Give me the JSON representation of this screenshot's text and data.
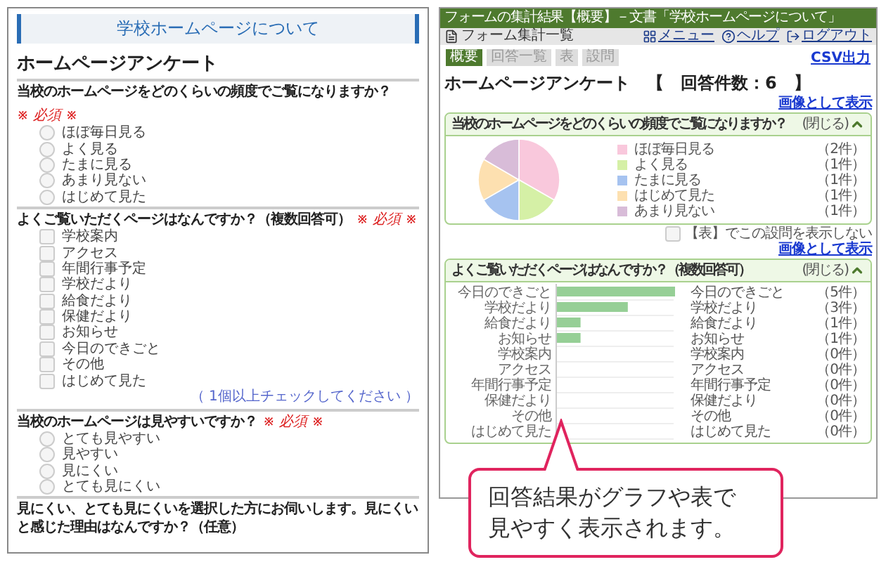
{
  "form": {
    "banner": "学校ホームページについて",
    "heading": "ホームページアンケート",
    "questions": [
      {
        "kind": "radio",
        "text": "当校のホームページをどのくらいの頻度でご覧になりますか？",
        "required_mark": "※ 必須 ※",
        "options": [
          {
            "label": "ほぼ毎日見る",
            "selected": false
          },
          {
            "label": "よく見る",
            "selected": false
          },
          {
            "label": "たまに見る",
            "selected": false
          },
          {
            "label": "あまり見ない",
            "selected": false
          },
          {
            "label": "はじめて見た",
            "selected": false
          }
        ]
      },
      {
        "kind": "checkbox",
        "text": "よくご覧いただくページはなんですか？（複数回答可）",
        "required_mark": "※ 必須 ※",
        "options": [
          {
            "label": "学校案内",
            "checked": false
          },
          {
            "label": "アクセス",
            "checked": false
          },
          {
            "label": "年間行事予定",
            "checked": false
          },
          {
            "label": "学校だより",
            "checked": false
          },
          {
            "label": "給食だより",
            "checked": false
          },
          {
            "label": "保健だより",
            "checked": false
          },
          {
            "label": "お知らせ",
            "checked": false
          },
          {
            "label": "今日のできごと",
            "checked": false
          },
          {
            "label": "その他",
            "checked": false
          },
          {
            "label": "はじめて見た",
            "checked": false
          }
        ],
        "hint": "（ 1個以上チェックしてください ）"
      },
      {
        "kind": "radio",
        "text": "当校のホームページは見やすいですか？",
        "required_mark": "※ 必須 ※",
        "options": [
          {
            "label": "とても見やすい",
            "selected": false
          },
          {
            "label": "見やすい",
            "selected": false
          },
          {
            "label": "見にくい",
            "selected": false
          },
          {
            "label": "とても見にくい",
            "selected": false
          }
        ]
      },
      {
        "kind": "text",
        "text": "見にくい、とても見にくいを選択した方にお伺いします。見にくいと感じた理由はなんですか？（任意）"
      }
    ]
  },
  "results": {
    "title_bar": "フォームの集計結果【概要】－文書「学校ホームページについて」",
    "menu_links": [
      {
        "kind": "menu",
        "label": "メニュー"
      },
      {
        "kind": "help",
        "label": "ヘルプ"
      },
      {
        "kind": "logout",
        "label": "ログアウト"
      }
    ],
    "breadcrumb": "フォーム集計一覧",
    "tabs": [
      {
        "label": "概要",
        "selected": true
      },
      {
        "label": "回答一覧",
        "selected": false
      },
      {
        "label": "表",
        "selected": false
      },
      {
        "label": "設問",
        "selected": false
      }
    ],
    "csv_link": "CSV出力",
    "heading": "ホームページアンケート　【　回答件数：6　】",
    "cards": [
      {
        "image_link": "画像として表示",
        "title": "当校のホームページをどのくらいの頻度でご覧になりますか？",
        "collapse_label": "(閉じる)",
        "legend": [
          {
            "count": "（2件）",
            "color": "#f9c8dc"
          },
          {
            "count": "（1件）",
            "color": "#d5f0a6"
          },
          {
            "count": "（1件）",
            "color": "#a6c3f0"
          },
          {
            "count": "（1件）",
            "color": "#fde0b0"
          },
          {
            "count": "（1件）",
            "color": "#d8bcd8"
          }
        ],
        "chart_data": {
          "type": "pie",
          "categories": [
            "ほぼ毎日見る",
            "よく見る",
            "たまに見る",
            "はじめて見た",
            "あまり見ない"
          ],
          "values": [
            33.3,
            16.7,
            16.7,
            16.7,
            16.6
          ]
        },
        "hide_option": {
          "label": "【表】でこの設問を表示しない",
          "checked": false
        }
      },
      {
        "image_link": "画像として表示",
        "title": "よくご覧いただくページはなんですか？（複数回答可）",
        "collapse_label": "(閉じる)",
        "chart_data": {
          "type": "bar",
          "orientation": "horizontal",
          "categories": [
            "今日のできごと",
            "学校だより",
            "給食だより",
            "お知らせ",
            "学校案内",
            "アクセス",
            "年間行事予定",
            "保健だより",
            "その他",
            "はじめて見た"
          ],
          "values": [
            5,
            3,
            1,
            1,
            0,
            0,
            0,
            0,
            0,
            0
          ],
          "value_labels": [
            "（5件）",
            "（3件）",
            "（1件）",
            "（1件）",
            "（0件）",
            "（0件）",
            "（0件）",
            "（0件）",
            "（0件）",
            "（0件）"
          ]
        },
        "legend": [
          {
            "label": "今日のできごと"
          },
          {
            "label": "学校だより"
          },
          {
            "label": "給食だより"
          },
          {
            "label": "お知らせ"
          },
          {
            "label": "学校案内"
          },
          {
            "label": "アクセス"
          },
          {
            "label": "年間行事予定"
          },
          {
            "label": "保健だより"
          },
          {
            "label": "その他"
          },
          {
            "label": "はじめて見た"
          }
        ]
      }
    ]
  },
  "callout": {
    "text": "回答結果がグラフや表で見やすく表示されます。"
  }
}
